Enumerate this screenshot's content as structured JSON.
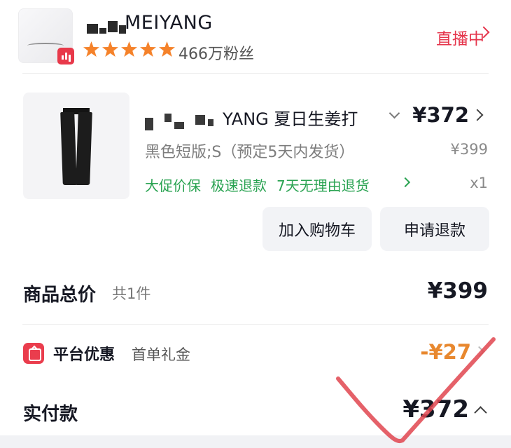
{
  "store": {
    "name": "MEIYANG",
    "fans": "466万粉丝",
    "rating_stars": 5,
    "live_label": "直播中"
  },
  "product": {
    "title": "YANG 夏日生姜打",
    "sku": "黑色短版;S（预定5天内发货）",
    "price_now": "¥372",
    "price_original": "¥399",
    "quantity": "x1",
    "services": [
      "大促价保",
      "极速退款",
      "7天无理由退货"
    ],
    "buttons": {
      "add_to_cart": "加入购物车",
      "refund": "申请退款"
    }
  },
  "summary": {
    "total_label": "商品总价",
    "total_count": "共1件",
    "total_price": "¥399",
    "discount_label": "平台优惠",
    "discount_sub": "首单礼金",
    "discount_value": "-¥27",
    "paid_label": "实付款",
    "paid_price": "¥372"
  },
  "colors": {
    "accent_red": "#e5344b",
    "service_green": "#2aa352",
    "discount_orange": "#e8882f",
    "star_orange": "#f5822a",
    "annotation_red": "#e0454f"
  }
}
